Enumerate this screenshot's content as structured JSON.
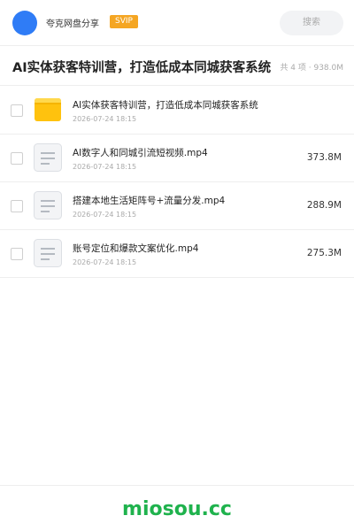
{
  "header": {
    "user_name": "夸克网盘分享",
    "badge": "SVIP",
    "search_label": "搜索",
    "brand_color": "#2f7cf6"
  },
  "folder": {
    "title": "AI实体获客特训营，打造低成本同城获客系统",
    "meta": "共 4 项 · 938.0M"
  },
  "files": [
    {
      "icon": "folder-icon",
      "name": "AI实体获客特训营，打造低成本同城获客系统",
      "date": "2026-07-24 18:15",
      "size": ""
    },
    {
      "icon": "document-icon",
      "name": "AI数字人和同城引流短视频.mp4",
      "date": "2026-07-24 18:15",
      "size": "373.8M"
    },
    {
      "icon": "document-icon",
      "name": "搭建本地生活矩阵号+流量分发.mp4",
      "date": "2026-07-24 18:15",
      "size": "288.9M"
    },
    {
      "icon": "document-icon",
      "name": "账号定位和爆款文案优化.mp4",
      "date": "2026-07-24 18:15",
      "size": "275.3M"
    }
  ],
  "footer": {
    "brand": "miosou.cc",
    "brand_color": "#1fb24d"
  }
}
